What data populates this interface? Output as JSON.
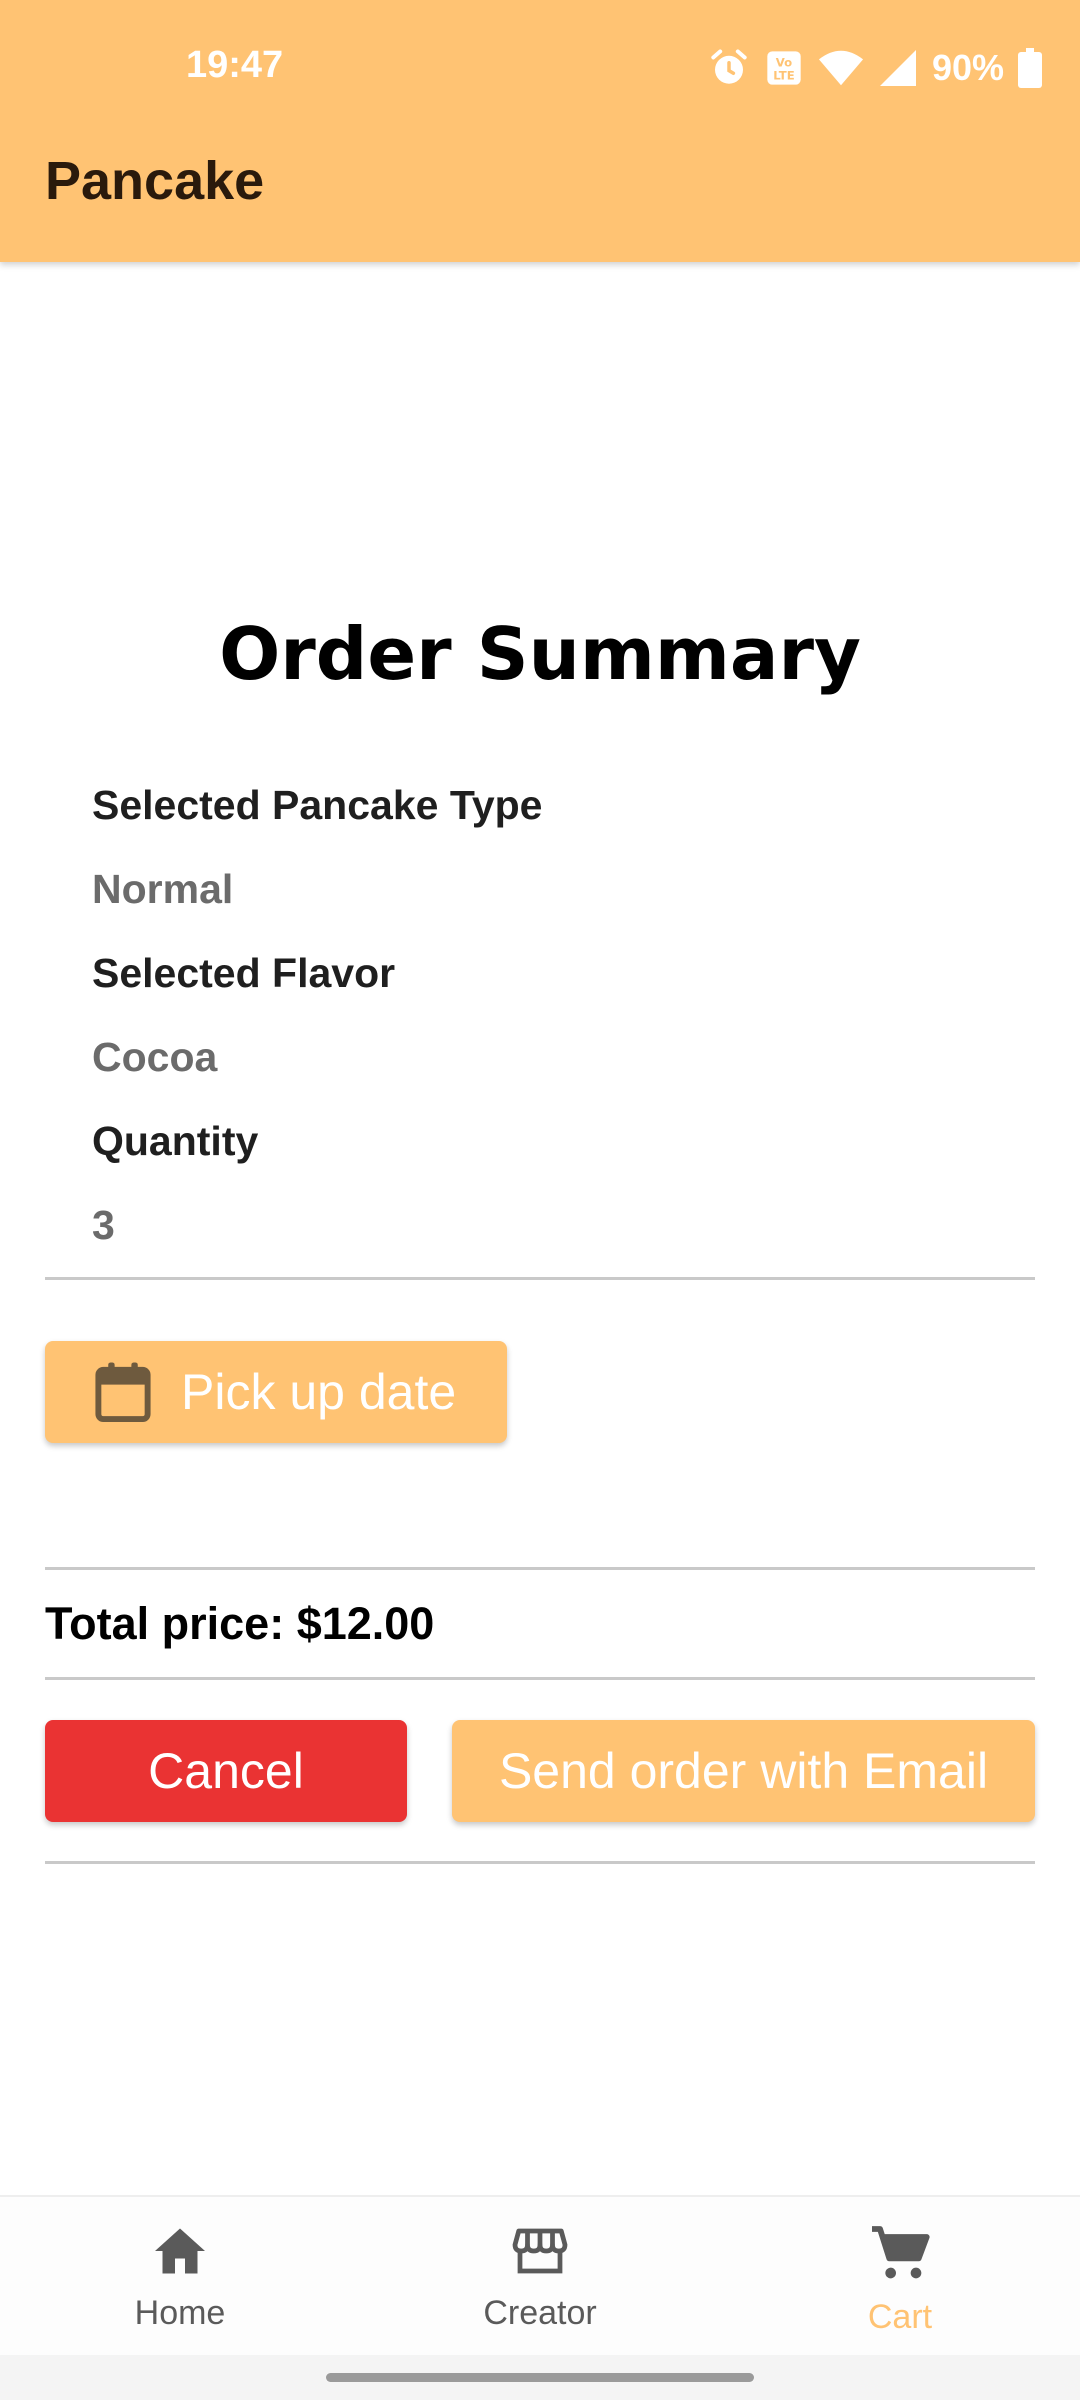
{
  "status_bar": {
    "time": "19:47",
    "battery": "90%",
    "icons": [
      "alarm-icon",
      "volte-icon",
      "wifi-icon",
      "signal-icon",
      "battery-icon"
    ]
  },
  "app_bar": {
    "title": "Pancake"
  },
  "summary": {
    "title": "Order Summary",
    "fields": [
      {
        "label": "Selected Pancake Type",
        "value": "Normal"
      },
      {
        "label": "Selected Flavor",
        "value": "Cocoa"
      },
      {
        "label": "Quantity",
        "value": "3"
      }
    ]
  },
  "pickup": {
    "label": "Pick up date",
    "icon": "calendar-icon"
  },
  "total": {
    "text": "Total price: $12.00"
  },
  "actions": {
    "cancel_label": "Cancel",
    "send_label": "Send order with Email"
  },
  "bottom_nav": {
    "items": [
      {
        "label": "Home",
        "icon": "home-icon",
        "active": false
      },
      {
        "label": "Creator",
        "icon": "store-icon",
        "active": false
      },
      {
        "label": "Cart",
        "icon": "cart-icon",
        "active": true
      }
    ]
  },
  "colors": {
    "accent": "#ffc373",
    "danger": "#ea3333",
    "nav_inactive": "#5a5a5a"
  }
}
